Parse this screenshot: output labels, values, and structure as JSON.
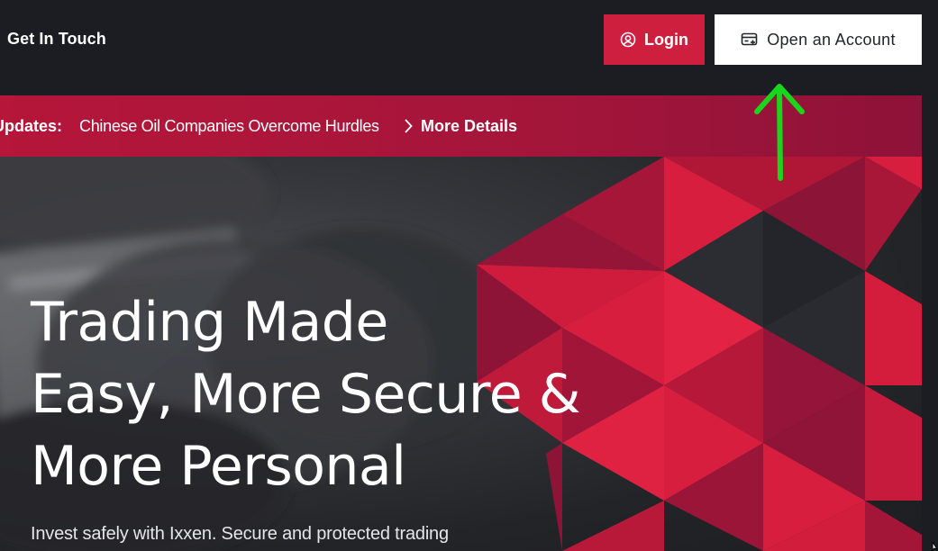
{
  "header": {
    "get_in_touch": "Get In Touch",
    "login_label": "Login",
    "open_account_label": "Open an Account",
    "login_icon": "user-circle-icon",
    "open_account_icon": "card-plus-icon"
  },
  "updates": {
    "label": "Updates:",
    "headline": "Chinese Oil Companies Overcome Hurdles",
    "more_label": "More Details",
    "chevron_icon": "chevron-right-icon"
  },
  "hero": {
    "title_lines": [
      "Trading Made",
      "Easy, More Secure &",
      "More Personal"
    ],
    "subtitle": "Invest safely with Ixxen. Secure and protected trading"
  },
  "annotation": {
    "arrow_icon": "green-up-arrow-icon",
    "arrow_color": "#19d61c"
  },
  "colors": {
    "brand_red": "#cf1f3e",
    "dark_red": "#8e1239",
    "background": "#1b1d22"
  }
}
